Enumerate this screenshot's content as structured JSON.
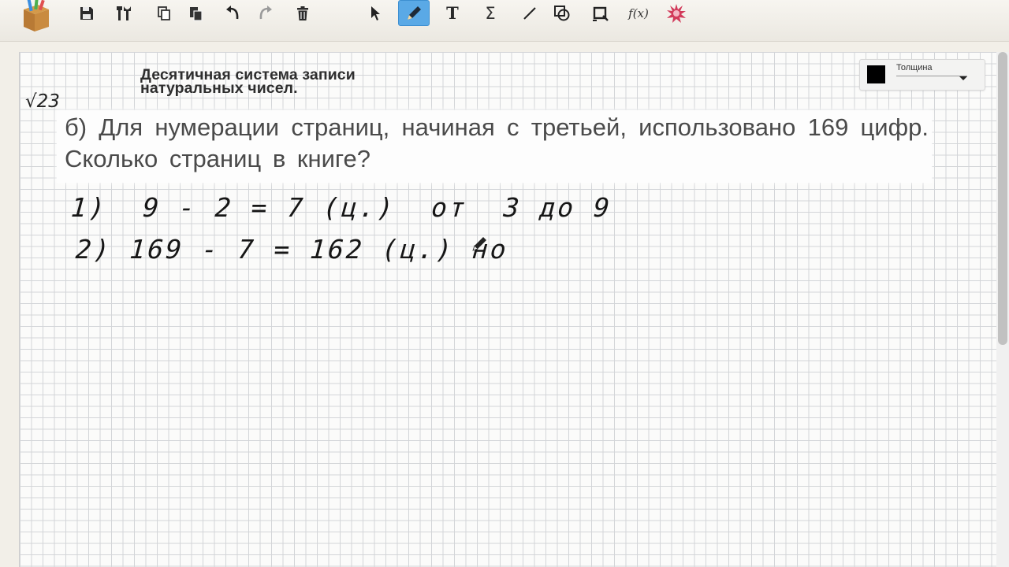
{
  "toolbar": {
    "tools": [
      {
        "name": "save",
        "icon": "save-icon"
      },
      {
        "name": "tools",
        "icon": "tools-icon"
      },
      {
        "name": "copy",
        "icon": "copy-icon"
      },
      {
        "name": "paste",
        "icon": "paste-icon"
      },
      {
        "name": "undo",
        "icon": "undo-icon"
      },
      {
        "name": "redo",
        "icon": "redo-icon"
      },
      {
        "name": "delete",
        "icon": "trash-icon"
      },
      {
        "name": "select",
        "icon": "cursor-arrow-icon"
      },
      {
        "name": "pen",
        "icon": "pen-icon",
        "active": true
      },
      {
        "name": "text",
        "icon": "text-tool-icon",
        "glyph": "T"
      },
      {
        "name": "formula",
        "icon": "sigma-icon",
        "glyph": "Σ"
      },
      {
        "name": "line",
        "icon": "line-icon"
      },
      {
        "name": "shapes",
        "icon": "shapes-icon"
      },
      {
        "name": "screenshot",
        "icon": "crop-icon"
      },
      {
        "name": "function",
        "icon": "fx-icon",
        "glyph": "f(x)"
      },
      {
        "name": "effects",
        "icon": "star-burst-icon"
      }
    ],
    "accent_color": "#5aa9e6"
  },
  "canvas": {
    "topic_title": "Десятичная система записи\nнатуральных чисел.",
    "problem_number": "√23",
    "problem_text": "б) Для нумерации страниц, начиная с третьей, использовано 169 цифр. Сколько страниц в книге?",
    "handwriting": [
      "1)  9 - 2 = 7 (ц.)  от  3 до 9",
      "2) 169 - 7 = 162 (ц.) но"
    ]
  },
  "thickness_panel": {
    "label": "Толщина",
    "color": "#000000"
  }
}
